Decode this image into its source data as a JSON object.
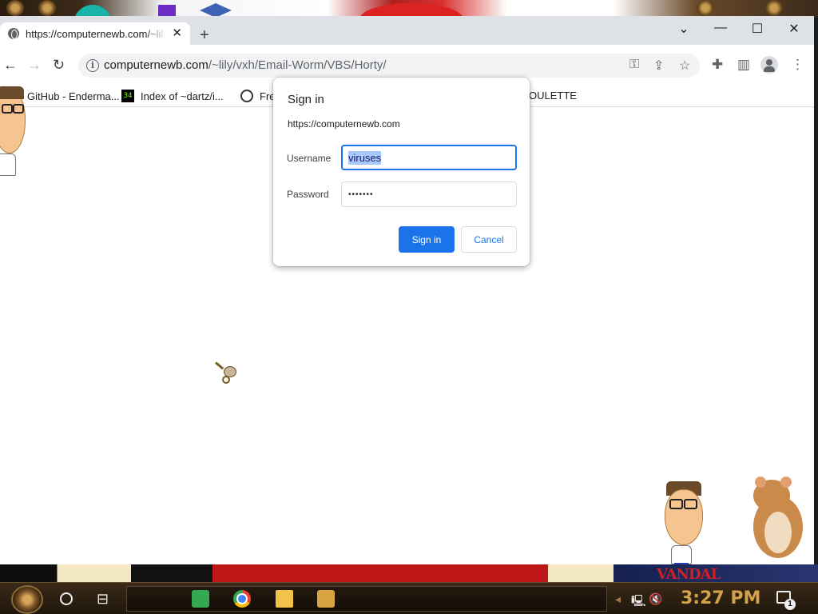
{
  "browser": {
    "tab": {
      "title": "https://computernewb.com/~lily/vxh/Email-Worm/VBS/Horty/"
    },
    "window_controls": {
      "dropdown": "⌄",
      "minimize": "—",
      "maximize": "☐",
      "close": "✕"
    },
    "address_bar": {
      "host": "computernewb.com",
      "path": "/~lily/vxh/Email-Worm/VBS/Horty/"
    },
    "bookmarks": [
      {
        "label": "GitHub - Enderma..."
      },
      {
        "label": "Index of ~dartz/i..."
      },
      {
        "label": "Fre"
      },
      {
        "label": "OULETTE"
      }
    ],
    "bookmark_index_icon_text": "34"
  },
  "dialog": {
    "title": "Sign in",
    "origin": "https://computernewb.com",
    "username_label": "Username",
    "username_value": "viruses",
    "password_label": "Password",
    "password_value": "•••••••",
    "signin_button": "Sign in",
    "cancel_button": "Cancel"
  },
  "taskbar": {
    "clock": "3:27 PM",
    "notification_count": "1"
  },
  "desktop": {
    "wallpaper_text": "VANDAL"
  },
  "colors": {
    "accent": "#1a73e8",
    "tab_strip": "#dee1e6",
    "clock": "#d4a24a"
  },
  "icons": [
    "globe-icon",
    "close-icon",
    "plus-icon",
    "back-icon",
    "forward-icon",
    "reload-icon",
    "info-icon",
    "key-icon",
    "share-icon",
    "star-icon",
    "extensions-icon",
    "side-panel-icon",
    "profile-icon",
    "menu-icon",
    "start-icon",
    "search-icon",
    "task-view-icon",
    "notes-icon",
    "chrome-icon",
    "folder-icon",
    "bonzi-icon",
    "network-icon",
    "volume-muted-icon",
    "notification-icon"
  ]
}
